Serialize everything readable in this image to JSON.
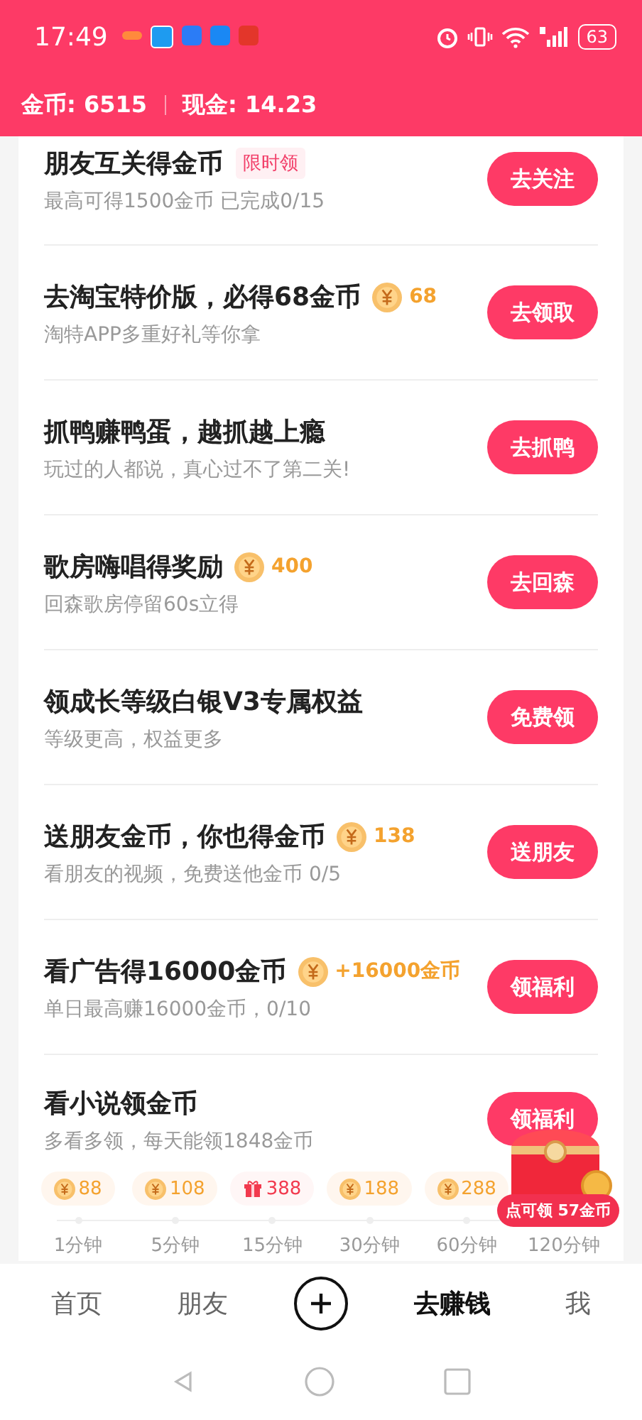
{
  "status_bar": {
    "time": "17:49",
    "battery": "63"
  },
  "wallet": {
    "coins_label": "金币: 6515",
    "cash_label": "现金: 14.23"
  },
  "tasks": [
    {
      "title": "朋友互关得金币",
      "badge": {
        "kind": "tag",
        "text": "限时领"
      },
      "subtitle": "最高可得1500金币 已完成0/15",
      "button": "去关注"
    },
    {
      "title": "去淘宝特价版，必得68金币",
      "badge": {
        "kind": "coin",
        "text": "68"
      },
      "subtitle": "淘特APP多重好礼等你拿",
      "button": "去领取"
    },
    {
      "title": "抓鸭赚鸭蛋，越抓越上瘾",
      "subtitle": "玩过的人都说，真心过不了第二关!",
      "button": "去抓鸭"
    },
    {
      "title": "歌房嗨唱得奖励",
      "badge": {
        "kind": "coin",
        "text": "400"
      },
      "subtitle": "回森歌房停留60s立得",
      "button": "去回森"
    },
    {
      "title": "领成长等级白银V3专属权益",
      "subtitle": "等级更高，权益更多",
      "button": "免费领"
    },
    {
      "title": "送朋友金币，你也得金币",
      "badge": {
        "kind": "coin",
        "text": "138"
      },
      "subtitle": "看朋友的视频，免费送他金币 0/5",
      "button": "送朋友"
    },
    {
      "title": "看广告得16000金币",
      "badge": {
        "kind": "coin",
        "text": "+16000金币"
      },
      "subtitle": "单日最高赚16000金币，0/10",
      "button": "领福利"
    },
    {
      "title": "看小说领金币",
      "subtitle": "多看多领，每天能领1848金币",
      "button": "领福利",
      "timeline": [
        {
          "kind": "coin",
          "amount": "88",
          "time": "1分钟"
        },
        {
          "kind": "coin",
          "amount": "108",
          "time": "5分钟"
        },
        {
          "kind": "gift",
          "amount": "388",
          "time": "15分钟"
        },
        {
          "kind": "coin",
          "amount": "188",
          "time": "30分钟"
        },
        {
          "kind": "coin",
          "amount": "288",
          "time": "60分钟"
        },
        {
          "kind": "hidden",
          "time": "120分钟"
        }
      ]
    }
  ],
  "chest_popup": {
    "label": "点可领 57金币"
  },
  "bottom_nav": [
    {
      "kind": "text",
      "label": "首页",
      "selected": false
    },
    {
      "kind": "text",
      "label": "朋友",
      "selected": false
    },
    {
      "kind": "plus"
    },
    {
      "kind": "text",
      "label": "去赚钱",
      "selected": true
    },
    {
      "kind": "text",
      "label": "我",
      "selected": false
    }
  ]
}
